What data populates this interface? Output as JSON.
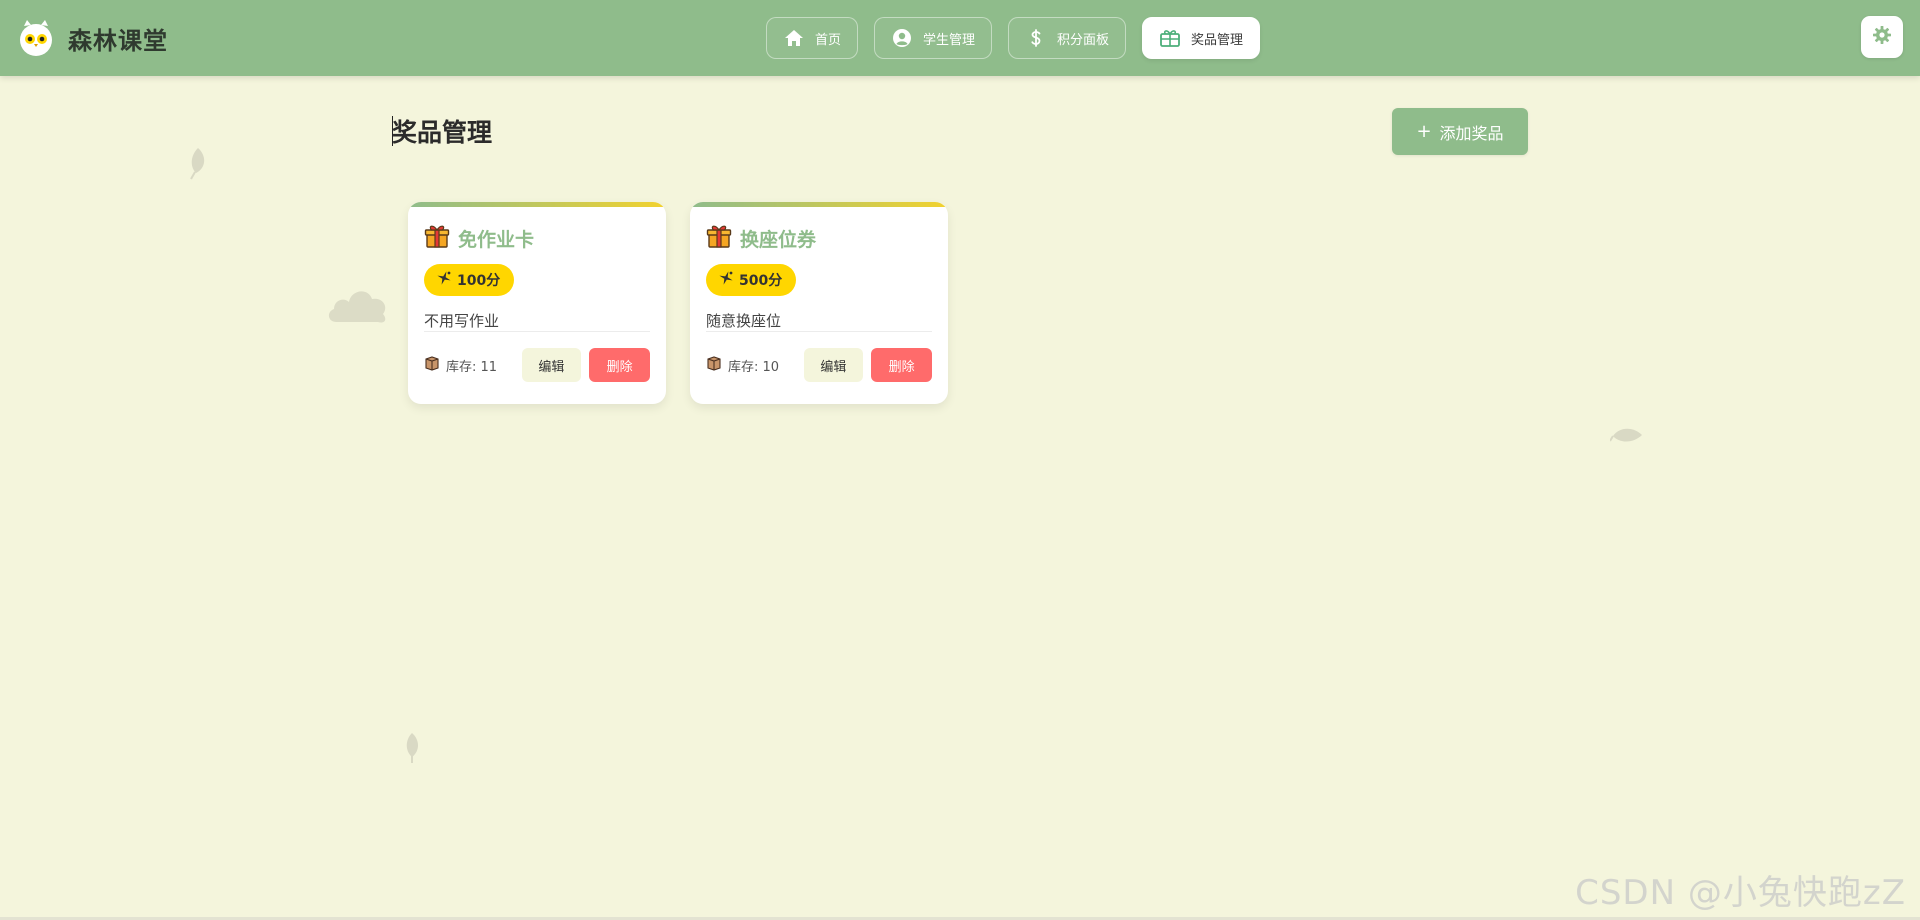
{
  "app": {
    "title": "森林课堂"
  },
  "nav": {
    "items": [
      {
        "label": "首页",
        "icon": "home-icon",
        "active": false
      },
      {
        "label": "学生管理",
        "icon": "user-circle-icon",
        "active": false
      },
      {
        "label": "积分面板",
        "icon": "dollar-icon",
        "active": false
      },
      {
        "label": "奖品管理",
        "icon": "gift-box-icon",
        "active": true
      }
    ]
  },
  "settings": {
    "icon": "gear-icon"
  },
  "page": {
    "title": "奖品管理",
    "add_button": {
      "icon": "plus-icon",
      "label": "添加奖品"
    }
  },
  "prizes": [
    {
      "icon": "gift-icon",
      "name": "免作业卡",
      "points_icon": "sparkle-icon",
      "points": "100分",
      "description": "不用写作业",
      "stock_icon": "box-icon",
      "stock_label": "库存: 11",
      "edit_label": "编辑",
      "delete_label": "删除"
    },
    {
      "icon": "gift-icon",
      "name": "换座位券",
      "points_icon": "sparkle-icon",
      "points": "500分",
      "description": "随意换座位",
      "stock_icon": "box-icon",
      "stock_label": "库存: 10",
      "edit_label": "编辑",
      "delete_label": "删除"
    }
  ],
  "watermark": "CSDN @小兔快跑zZ",
  "colors": {
    "header": "#8fbc8b",
    "background": "#f4f5dc",
    "accent_green": "#8fbc8b",
    "points_badge": "#ffd600",
    "delete": "#ff6b6b"
  }
}
